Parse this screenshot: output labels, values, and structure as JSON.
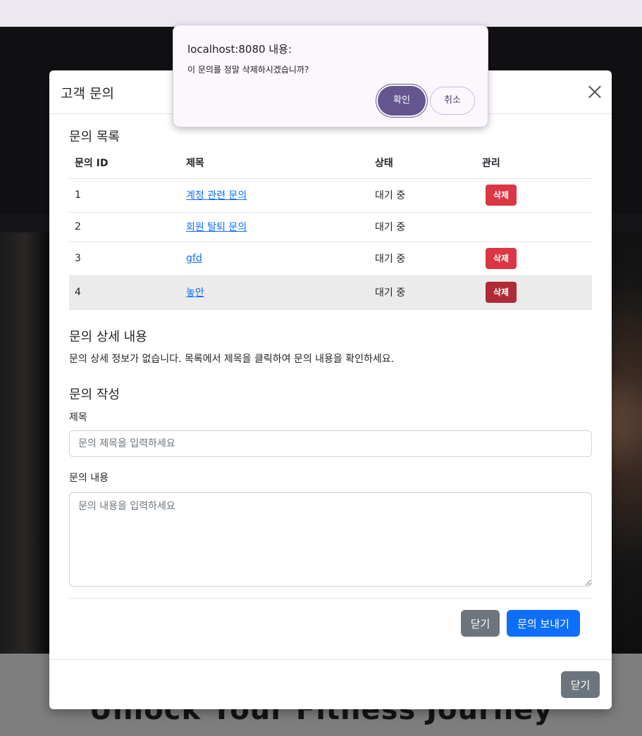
{
  "background": {
    "headline": "Unlock Your Fitness Journey"
  },
  "modal": {
    "title": "고객 문의",
    "list_section_title": "문의 목록",
    "table": {
      "headers": [
        "문의 ID",
        "제목",
        "상태",
        "관리"
      ],
      "rows": [
        {
          "id": "1",
          "title": "계정 관련 문의",
          "status": "대기 중",
          "action": "삭제"
        },
        {
          "id": "2",
          "title": "회원 탈퇴 문의",
          "status": "대기 중",
          "action": ""
        },
        {
          "id": "3",
          "title": "gfd",
          "status": "대기 중",
          "action": "삭제"
        },
        {
          "id": "4",
          "title": "놓안",
          "status": "대기 중",
          "action": "삭제"
        }
      ]
    },
    "detail_section_title": "문의 상세 내용",
    "detail_empty_text": "문의 상세 정보가 없습니다. 목록에서 제목을 클릭하여 문의 내용을 확인하세요.",
    "write_section_title": "문의 작성",
    "form": {
      "title_label": "제목",
      "title_value": "",
      "title_placeholder": "문의 제목을 입력하세요",
      "content_label": "문의 내용",
      "content_value": "",
      "content_placeholder": "문의 내용을 입력하세요",
      "close_label": "닫기",
      "send_label": "문의 보내기"
    },
    "footer_close_label": "닫기"
  },
  "confirm_dialog": {
    "origin": "localhost:8080 내용:",
    "message": "이 문의를 정말 삭제하시겠습니까?",
    "ok_label": "확인",
    "cancel_label": "취소"
  },
  "colors": {
    "primary": "#0d6efd",
    "danger": "#dc3545",
    "secondary": "#6c757d",
    "dialog_accent": "#65558f"
  }
}
